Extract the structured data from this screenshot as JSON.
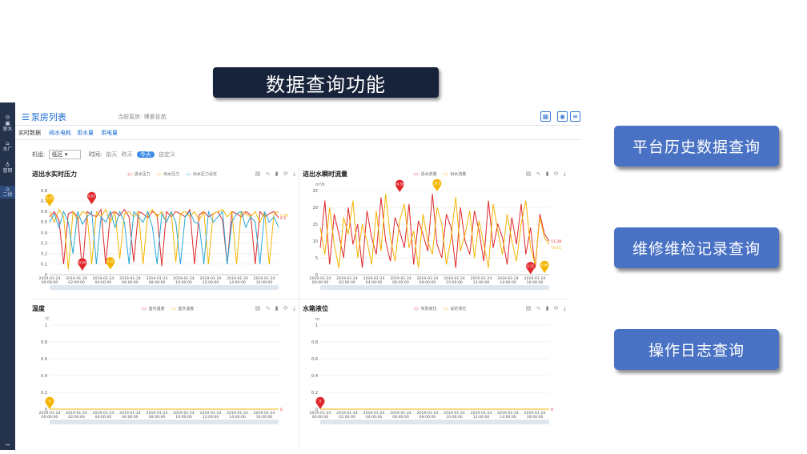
{
  "slide": {
    "title": "数据查询功能",
    "features": [
      "平台历史数据查询",
      "维修维检记录查询",
      "操作日志查询"
    ]
  },
  "sidebar": {
    "items": [
      {
        "icon": "◎",
        "label": ""
      },
      {
        "icon": "▣",
        "label": "原水"
      },
      {
        "icon": "⌂",
        "label": "水厂"
      },
      {
        "icon": "♁",
        "label": "管网"
      },
      {
        "icon": "⌂",
        "label": "二供"
      }
    ],
    "expand": "↔"
  },
  "header": {
    "title": "泵房列表",
    "current_label": "当前泵房:",
    "current_value": "博爱花苑"
  },
  "tabs": [
    "实时数据",
    "阀水电耗",
    "用水量",
    "用电量"
  ],
  "filter": {
    "unit_label": "机组:",
    "unit_value": "低区",
    "period_label": "时间:",
    "options": [
      "前天",
      "昨天",
      "今天",
      "自定义"
    ],
    "active": "今天"
  },
  "colors": {
    "red": "#e0282c",
    "yellow": "#f5b400",
    "blue": "#28a8d8",
    "accent": "#1a6dd6"
  },
  "tools_icons": [
    "table-icon",
    "chart-line-icon",
    "chart-bar-icon",
    "refresh-icon",
    "download-icon"
  ],
  "charts": [
    {
      "id": "pressure",
      "chart_data": {
        "type": "line",
        "title": "进出水实时压力",
        "ylabel": "",
        "ylim": [
          0,
          0.8
        ],
        "yticks": [
          "0",
          "0.1",
          "0.2",
          "0.3",
          "0.4",
          "0.5",
          "0.6",
          "0.7",
          "0.8"
        ],
        "xticks": [
          "2019-01-24 00:00:00",
          "2019-01-24 02:00:00",
          "2019-01-24 04:00:00",
          "2019-01-24 06:00:00",
          "2019-01-24 08:00:00",
          "2019-01-24 10:00:00",
          "2019-01-24 12:00:00",
          "2019-01-24 14:00:00",
          "2019-01-24 16:00:00"
        ],
        "series": [
          {
            "name": "进水压力",
            "color": "#e0282c",
            "values": [
              0.55,
              0.6,
              0.52,
              0.1,
              0.58,
              0.6,
              0.55,
              0.04,
              0.6,
              0.57,
              0.55,
              0.62,
              0.1,
              0.58,
              0.6,
              0.56,
              0.62,
              0.55,
              0.12,
              0.6,
              0.58,
              0.54,
              0.6,
              0.57,
              0.08,
              0.6,
              0.55,
              0.6,
              0.58,
              0.55,
              0.62,
              0.1,
              0.57,
              0.6,
              0.55,
              0.58,
              0.6,
              0.52,
              0.1,
              0.6,
              0.58,
              0.55,
              0.6,
              0.57,
              0.1,
              0.6,
              0.55,
              0.58,
              0.6,
              0.54
            ]
          },
          {
            "name": "出水压力",
            "color": "#f5b400",
            "values": [
              0.6,
              0.5,
              0.62,
              0.55,
              0.05,
              0.6,
              0.52,
              0.6,
              0.58,
              0.1,
              0.6,
              0.55,
              0.62,
              0.5,
              0.6,
              0.15,
              0.58,
              0.6,
              0.55,
              0.6,
              0.1,
              0.58,
              0.62,
              0.55,
              0.6,
              0.5,
              0.6,
              0.12,
              0.58,
              0.6,
              0.55,
              0.6,
              0.52,
              0.6,
              0.1,
              0.58,
              0.6,
              0.62,
              0.55,
              0.6,
              0.1,
              0.6,
              0.58,
              0.55,
              0.6,
              0.5,
              0.6,
              0.1,
              0.58,
              0.6
            ]
          },
          {
            "name": "出水压力设定",
            "color": "#28a8d8",
            "values": [
              0.5,
              0.58,
              0.45,
              0.6,
              0.5,
              0.2,
              0.6,
              0.48,
              0.55,
              0.6,
              0.1,
              0.55,
              0.5,
              0.6,
              0.45,
              0.6,
              0.5,
              0.1,
              0.6,
              0.55,
              0.5,
              0.6,
              0.45,
              0.1,
              0.58,
              0.5,
              0.6,
              0.5,
              0.1,
              0.55,
              0.6,
              0.5,
              0.48,
              0.1,
              0.6,
              0.5,
              0.55,
              0.6,
              0.1,
              0.5,
              0.58,
              0.6,
              0.45,
              0.55,
              0.5,
              0.1,
              0.6,
              0.5,
              0.55,
              0.45
            ]
          }
        ],
        "markers": [
          {
            "label": "0.65",
            "color": "#f5b400",
            "i": 0,
            "v": 0.65
          },
          {
            "label": "0.67",
            "color": "#e0282c",
            "i": 9,
            "v": 0.67
          },
          {
            "label": "0.04",
            "color": "#e0282c",
            "i": 7,
            "v": 0.04
          },
          {
            "label": "0.05",
            "color": "#f5b400",
            "i": 13,
            "v": 0.05
          }
        ],
        "end_labels": [
          "0.5",
          "0.49"
        ]
      }
    },
    {
      "id": "flow",
      "chart_data": {
        "type": "line",
        "title": "进出水瞬时流量",
        "ylabel": "m³/h",
        "ylim": [
          0,
          25
        ],
        "yticks": [
          "0",
          "5",
          "10",
          "15",
          "20",
          "25"
        ],
        "xticks": [
          "2019-01-24 00:00:00",
          "2019-01-24 02:00:00",
          "2019-01-24 04:00:00",
          "2019-01-24 06:00:00",
          "2019-01-24 08:00:00",
          "2019-01-24 10:00:00",
          "2019-01-24 12:00:00",
          "2019-01-24 14:00:00",
          "2019-01-24 16:00:00"
        ],
        "series": [
          {
            "name": "进水流量",
            "color": "#e0282c",
            "values": [
              8,
              22,
              3,
              18,
              12,
              5,
              20,
              9,
              15,
              2,
              19,
              11,
              6,
              23,
              10,
              4,
              17,
              13,
              8,
              21,
              3,
              16,
              12,
              7,
              24,
              9,
              5,
              18,
              14,
              2,
              20,
              10,
              6,
              19,
              13,
              4,
              22,
              8,
              15,
              11,
              3,
              17,
              9,
              21,
              6,
              14,
              2,
              18,
              12,
              10
            ]
          },
          {
            "name": "出水流量",
            "color": "#f5b400",
            "values": [
              14,
              6,
              20,
              9,
              2,
              17,
              12,
              22,
              5,
              15,
              10,
              3,
              19,
              7,
              24,
              11,
              4,
              16,
              21,
              8,
              13,
              2,
              18,
              10,
              6,
              20,
              15,
              3,
              11,
              23,
              7,
              12,
              19,
              5,
              16,
              9,
              2,
              21,
              13,
              6,
              18,
              10,
              4,
              15,
              22,
              8,
              3,
              17,
              11,
              9
            ]
          }
        ],
        "markers": [
          {
            "label": "24.56",
            "color": "#e0282c",
            "i": 17,
            "v": 24.56
          },
          {
            "label": "26.8",
            "color": "#f5b400",
            "i": 25,
            "v": 24.8
          },
          {
            "label": "0.15",
            "color": "#e0282c",
            "i": 45,
            "v": 0.15
          },
          {
            "label": "0.48",
            "color": "#f5b400",
            "i": 48,
            "v": 0.48
          }
        ],
        "end_labels": [
          "11.28",
          "10.15"
        ]
      }
    },
    {
      "id": "temperature",
      "chart_data": {
        "type": "line",
        "title": "温度",
        "ylabel": "℃",
        "ylim": [
          0,
          1
        ],
        "yticks": [
          "0",
          "0.2",
          "0.4",
          "0.6",
          "0.8",
          "1"
        ],
        "xticks": [
          "2019-01-24 00:00:00",
          "2019-01-24 02:00:00",
          "2019-01-24 04:00:00",
          "2019-01-24 06:00:00",
          "2019-01-24 08:00:00",
          "2019-01-24 10:00:00",
          "2019-01-24 12:00:00",
          "2019-01-24 14:00:00",
          "2019-01-24 16:00:00"
        ],
        "series": [
          {
            "name": "室内温度",
            "color": "#e0282c",
            "values": [
              0,
              0,
              0,
              0,
              0,
              0,
              0,
              0,
              0,
              0
            ]
          },
          {
            "name": "室外温度",
            "color": "#f5b400",
            "values": [
              0,
              0,
              0,
              0,
              0,
              0,
              0,
              0,
              0,
              0
            ]
          }
        ],
        "markers": [
          {
            "label": "0",
            "color": "#f5b400",
            "i": 0,
            "v": 0
          }
        ],
        "end_labels": [
          "0"
        ]
      }
    },
    {
      "id": "level",
      "chart_data": {
        "type": "line",
        "title": "水箱液位",
        "ylabel": "m",
        "ylim": [
          0,
          1
        ],
        "yticks": [
          "0",
          "0.2",
          "0.4",
          "0.6",
          "0.8",
          "1"
        ],
        "xticks": [
          "2019-01-24 00:00:00",
          "2019-01-24 02:00:00",
          "2019-01-24 04:00:00",
          "2019-01-24 06:00:00",
          "2019-01-24 08:00:00",
          "2019-01-24 10:00:00",
          "2019-01-24 12:00:00",
          "2019-01-24 14:00:00",
          "2019-01-24 16:00:00"
        ],
        "series": [
          {
            "name": "实际液位",
            "color": "#e0282c",
            "values": [
              0,
              0,
              0,
              0,
              0,
              0,
              0,
              0,
              0,
              0
            ]
          },
          {
            "name": "设定液位",
            "color": "#f5b400",
            "values": [
              0,
              0,
              0,
              0,
              0,
              0,
              0,
              0,
              0,
              0
            ]
          }
        ],
        "markers": [
          {
            "label": "0",
            "color": "#e0282c",
            "i": 0,
            "v": 0
          }
        ],
        "end_labels": [
          "0"
        ]
      }
    }
  ]
}
